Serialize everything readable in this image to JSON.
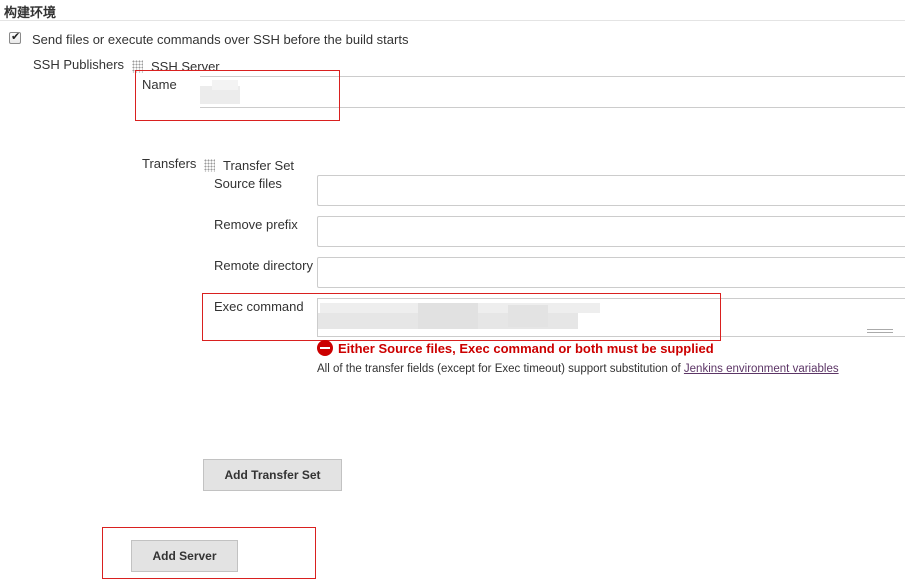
{
  "section": {
    "title": "构建环境"
  },
  "send_files": {
    "checked": true,
    "label": "Send files or execute commands over SSH before the build starts"
  },
  "ssh_publishers": {
    "label": "SSH Publishers",
    "server_header": "SSH Server",
    "name_label": "Name",
    "name_value": ""
  },
  "transfers": {
    "label": "Transfers",
    "set_header": "Transfer Set",
    "source_files_label": "Source files",
    "source_files_value": "",
    "remove_prefix_label": "Remove prefix",
    "remove_prefix_value": "",
    "remote_directory_label": "Remote directory",
    "remote_directory_value": "",
    "exec_command_label": "Exec command",
    "exec_command_value": ""
  },
  "validation": {
    "error": "Either Source files, Exec command or both must be supplied",
    "error_color": "#cc0000",
    "help_prefix": "All of the transfer fields (except for Exec timeout) support substitution of ",
    "help_link": "Jenkins environment variables"
  },
  "buttons": {
    "add_transfer_set": "Add Transfer Set",
    "add_server": "Add Server"
  },
  "annotation_color": "#d9201f"
}
